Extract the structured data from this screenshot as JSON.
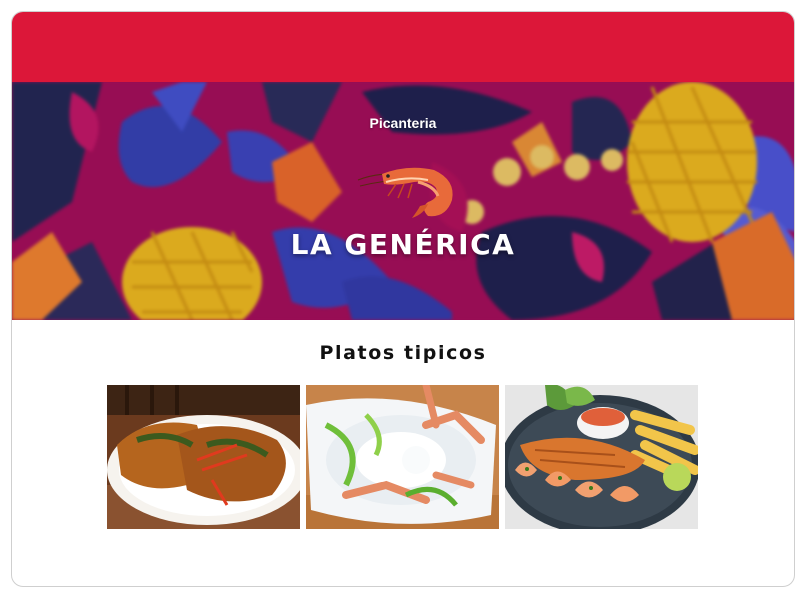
{
  "hero": {
    "subtitle": "Picanteria",
    "title": "LA GENÉRICA",
    "logo_icon": "shrimp-icon"
  },
  "colors": {
    "topbar": "#dc1739",
    "hero_background": "#a40f5a",
    "text_light": "#ffffff",
    "text_dark": "#111111"
  },
  "section": {
    "title": "Platos tipicos"
  },
  "dishes": [
    {
      "name": "dish-photo-1"
    },
    {
      "name": "dish-photo-2"
    },
    {
      "name": "dish-photo-3"
    }
  ]
}
